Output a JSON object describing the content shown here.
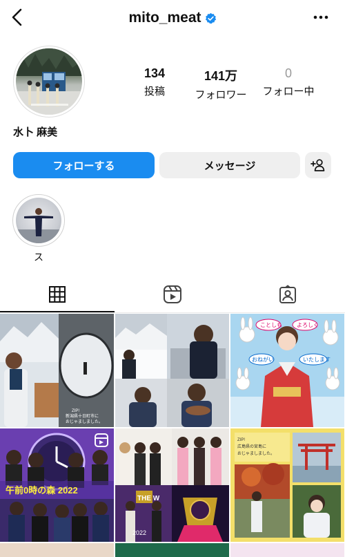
{
  "header": {
    "username": "mito_meat",
    "back_icon": "chevron-left-icon",
    "verified_icon": "verified-badge-icon",
    "more_icon": "more-horizontal-icon"
  },
  "profile": {
    "display_name": "水卜 麻美"
  },
  "stats": [
    {
      "number": "134",
      "label": "投稿"
    },
    {
      "number": "141万",
      "label": "フォロワー"
    },
    {
      "number": "0",
      "label": "フォロー中"
    }
  ],
  "actions": {
    "follow_label": "フォローする",
    "message_label": "メッセージ",
    "add_user_icon": "add-user-icon"
  },
  "highlights": [
    {
      "label": "ス"
    }
  ],
  "tabs": [
    {
      "name": "grid",
      "icon": "grid-icon",
      "active": true
    },
    {
      "name": "reels",
      "icon": "reels-icon",
      "active": false
    },
    {
      "name": "tagged",
      "icon": "tagged-icon",
      "active": false
    }
  ],
  "posts": [
    {
      "caption": "ZIP!\n新潟県十日町市に\nおじゃましました。"
    },
    {
      "caption": ""
    },
    {
      "caption": "ことしも よろしく おねがい いたします"
    },
    {
      "caption": "午前0時の森 2022",
      "type": "reel"
    },
    {
      "caption": "THE W 2022"
    },
    {
      "caption": "ZIP!\n広島県の宮島に\nおじゃましました。"
    }
  ],
  "colors": {
    "accent": "#1a8cf0",
    "verified": "#1a8cf0",
    "button_gray": "#efefef"
  }
}
